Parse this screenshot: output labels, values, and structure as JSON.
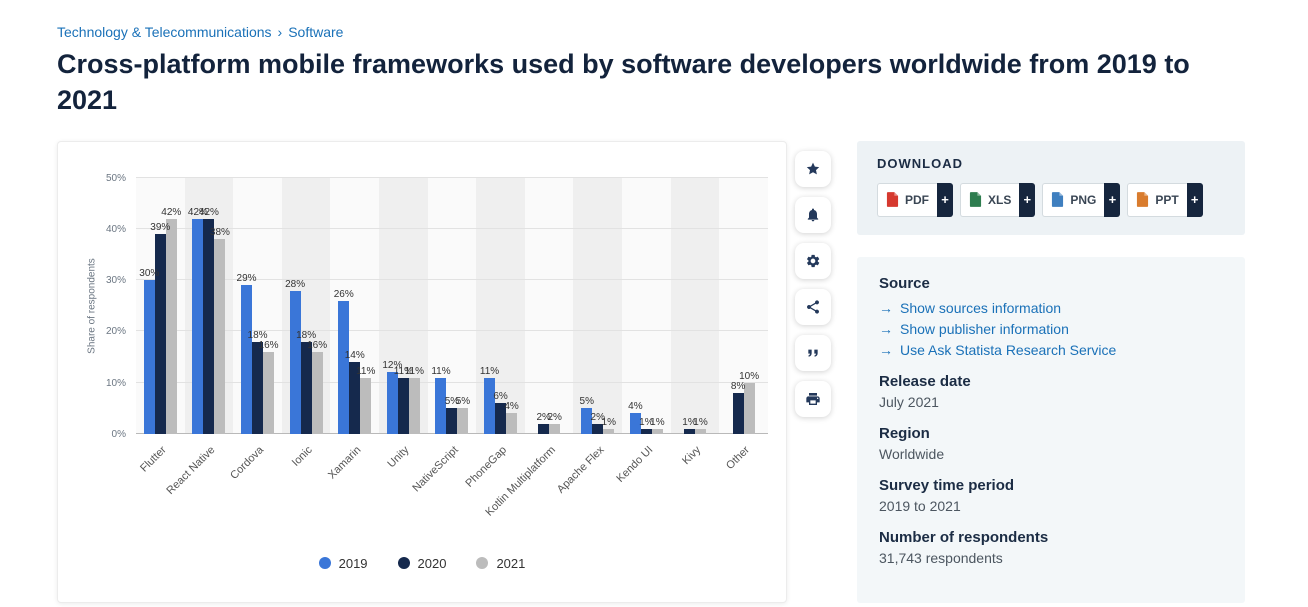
{
  "breadcrumb": {
    "category": "Technology & Telecommunications",
    "separator": "›",
    "subcategory": "Software"
  },
  "title": "Cross-platform mobile frameworks used by software developers worldwide from 2019 to 2021",
  "chart_data": {
    "type": "bar",
    "title": "Cross-platform mobile frameworks used by software developers worldwide from 2019 to 2021",
    "ylabel": "Share of respondents",
    "xlabel": "",
    "ylim": [
      0,
      50
    ],
    "yticks": [
      0,
      10,
      20,
      30,
      40,
      50
    ],
    "ytick_suffix": "%",
    "bar_value_suffix": "%",
    "grid": true,
    "legend_position": "bottom",
    "categories": [
      "Flutter",
      "React Native",
      "Cordova",
      "Ionic",
      "Xamarin",
      "Unity",
      "NativeScript",
      "PhoneGap",
      "Kotlin Multiplatform",
      "Apache Flex",
      "Kendo UI",
      "Kivy",
      "Other"
    ],
    "series": [
      {
        "name": "2019",
        "color": "#3a76d8",
        "values": [
          30,
          42,
          29,
          28,
          26,
          12,
          11,
          11,
          null,
          5,
          4,
          null,
          null
        ]
      },
      {
        "name": "2020",
        "color": "#15294d",
        "values": [
          39,
          42,
          18,
          18,
          14,
          11,
          5,
          6,
          2,
          2,
          1,
          1,
          8
        ]
      },
      {
        "name": "2021",
        "color": "#bcbcbc",
        "values": [
          42,
          38,
          16,
          16,
          11,
          11,
          5,
          4,
          2,
          1,
          1,
          1,
          10
        ]
      }
    ]
  },
  "toolbar": {
    "icons": [
      "favorite",
      "notifications",
      "settings",
      "share",
      "cite",
      "print"
    ]
  },
  "download": {
    "header": "DOWNLOAD",
    "plus_label": "+",
    "buttons": [
      {
        "label": "PDF",
        "icon_color": "#d6392f"
      },
      {
        "label": "XLS",
        "icon_color": "#2e7d4f"
      },
      {
        "label": "PNG",
        "icon_color": "#3f7fbf"
      },
      {
        "label": "PPT",
        "icon_color": "#d97c2e"
      }
    ]
  },
  "details": {
    "source_header": "Source",
    "link_arrow": "→",
    "links": [
      "Show sources information",
      "Show publisher information",
      "Use Ask Statista Research Service"
    ],
    "sections": [
      {
        "label": "Release date",
        "value": "July 2021"
      },
      {
        "label": "Region",
        "value": "Worldwide"
      },
      {
        "label": "Survey time period",
        "value": "2019 to 2021"
      },
      {
        "label": "Number of respondents",
        "value": "31,743 respondents"
      }
    ]
  }
}
